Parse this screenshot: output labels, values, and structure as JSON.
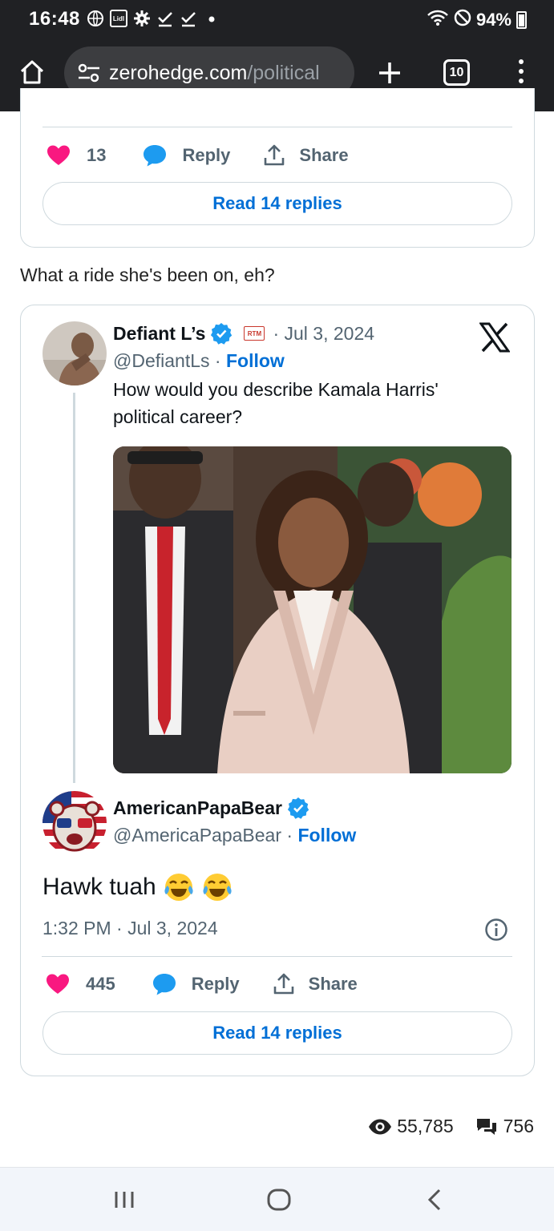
{
  "status_bar": {
    "time": "16:48",
    "battery": "94%",
    "app_icon_label": "Lidl"
  },
  "browser": {
    "url_domain": "zerohedge.com",
    "url_path": "/political",
    "tab_count": "10"
  },
  "first_tweet": {
    "like_count": "13",
    "reply_label": "Reply",
    "share_label": "Share",
    "read_replies_label": "Read 14 replies"
  },
  "article_text": "What a ride she's been on, eh?",
  "quoted_tweet": {
    "display_name": "Defiant L’s",
    "badge_label": "RTM",
    "date": "· Jul 3, 2024",
    "handle": "@DefiantLs",
    "separator": " · ",
    "follow_label": "Follow",
    "text": "How would you describe Kamala Harris' political career?"
  },
  "reply_tweet": {
    "display_name": "AmericanPapaBear",
    "handle": "@AmericaPapaBear",
    "separator": " · ",
    "follow_label": "Follow",
    "text": "Hawk tuah",
    "timestamp": "1:32 PM · Jul 3, 2024",
    "like_count": "445",
    "reply_label": "Reply",
    "share_label": "Share",
    "read_replies_label": "Read 14 replies"
  },
  "article_stats": {
    "views": "55,785",
    "comments": "756"
  },
  "colors": {
    "link_blue": "#006fd6",
    "like_pink": "#f91880",
    "verified_blue": "#1d9bf0",
    "chrome_dark": "#202124"
  }
}
